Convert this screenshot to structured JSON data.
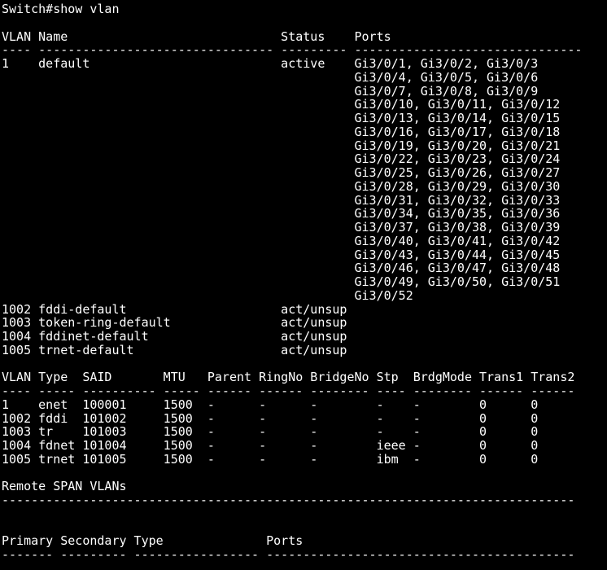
{
  "terminal": {
    "lines": [
      "Switch#show vlan",
      "",
      "VLAN Name                             Status    Ports",
      "---- -------------------------------- --------- -------------------------------",
      "1    default                          active    Gi3/0/1, Gi3/0/2, Gi3/0/3",
      "                                                Gi3/0/4, Gi3/0/5, Gi3/0/6",
      "                                                Gi3/0/7, Gi3/0/8, Gi3/0/9",
      "                                                Gi3/0/10, Gi3/0/11, Gi3/0/12",
      "                                                Gi3/0/13, Gi3/0/14, Gi3/0/15",
      "                                                Gi3/0/16, Gi3/0/17, Gi3/0/18",
      "                                                Gi3/0/19, Gi3/0/20, Gi3/0/21",
      "                                                Gi3/0/22, Gi3/0/23, Gi3/0/24",
      "                                                Gi3/0/25, Gi3/0/26, Gi3/0/27",
      "                                                Gi3/0/28, Gi3/0/29, Gi3/0/30",
      "                                                Gi3/0/31, Gi3/0/32, Gi3/0/33",
      "                                                Gi3/0/34, Gi3/0/35, Gi3/0/36",
      "                                                Gi3/0/37, Gi3/0/38, Gi3/0/39",
      "                                                Gi3/0/40, Gi3/0/41, Gi3/0/42",
      "                                                Gi3/0/43, Gi3/0/44, Gi3/0/45",
      "                                                Gi3/0/46, Gi3/0/47, Gi3/0/48",
      "                                                Gi3/0/49, Gi3/0/50, Gi3/0/51",
      "                                                Gi3/0/52",
      "1002 fddi-default                     act/unsup",
      "1003 token-ring-default               act/unsup",
      "1004 fddinet-default                  act/unsup",
      "1005 trnet-default                    act/unsup",
      "",
      "VLAN Type  SAID       MTU   Parent RingNo BridgeNo Stp  BrdgMode Trans1 Trans2",
      "---- ----- ---------- ----- ------ ------ -------- ---- -------- ------ ------",
      "1    enet  100001     1500  -      -      -        -    -        0      0",
      "1002 fddi  101002     1500  -      -      -        -    -        0      0",
      "1003 tr    101003     1500  -      -      -        -    -        0      0",
      "1004 fdnet 101004     1500  -      -      -        ieee -        0      0",
      "1005 trnet 101005     1500  -      -      -        ibm  -        0      0",
      "",
      "Remote SPAN VLANs",
      "------------------------------------------------------------------------------",
      "",
      "",
      "Primary Secondary Type              Ports",
      "------- --------- ----------------- ------------------------------------------"
    ]
  }
}
